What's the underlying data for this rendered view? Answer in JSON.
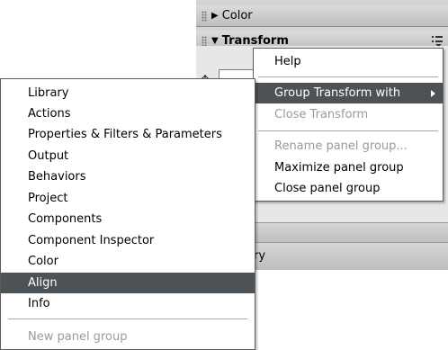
{
  "panels": {
    "color": {
      "label": "Color",
      "expanded": false
    },
    "transform": {
      "label": "Transform",
      "expanded": true
    },
    "library": {
      "label_fragment": "ry"
    }
  },
  "options_menu": {
    "items": [
      {
        "label": "Help",
        "state": "normal"
      },
      {
        "label": "Group Transform with",
        "state": "highlighted",
        "has_submenu": true
      },
      {
        "label": "Close Transform",
        "state": "disabled"
      },
      {
        "label": "Rename panel group...",
        "state": "disabled"
      },
      {
        "label": "Maximize panel group",
        "state": "normal"
      },
      {
        "label": "Close panel group",
        "state": "normal"
      }
    ]
  },
  "context_menu": {
    "items": [
      {
        "label": "Library",
        "state": "normal"
      },
      {
        "label": "Actions",
        "state": "normal"
      },
      {
        "label": "Properties & Filters & Parameters",
        "state": "normal"
      },
      {
        "label": "Output",
        "state": "normal"
      },
      {
        "label": "Behaviors",
        "state": "normal"
      },
      {
        "label": "Project",
        "state": "normal"
      },
      {
        "label": "Components",
        "state": "normal"
      },
      {
        "label": "Component Inspector",
        "state": "normal"
      },
      {
        "label": "Color",
        "state": "normal"
      },
      {
        "label": "Align",
        "state": "highlighted"
      },
      {
        "label": "Info",
        "state": "normal"
      },
      {
        "label": "New panel group",
        "state": "disabled"
      }
    ]
  },
  "colors": {
    "highlight_bg": "#4d5257",
    "highlight_fg": "#ffffff",
    "disabled_fg": "#9a9a9a",
    "panel_header": "#c8c8c8"
  }
}
